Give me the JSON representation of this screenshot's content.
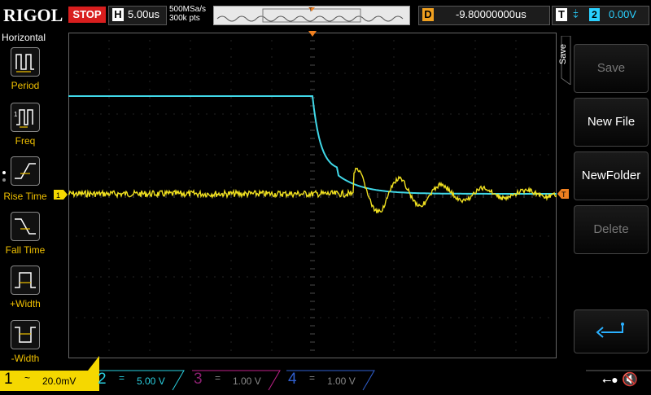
{
  "header": {
    "brand": "RIGOL",
    "run_state": "STOP",
    "horizontal": {
      "letter": "H",
      "timebase": "5.00us"
    },
    "sample_rate": "500MSa/s",
    "memory_depth": "300k pts",
    "delay": {
      "letter": "D",
      "value": "-9.80000000us"
    },
    "trigger": {
      "letter": "T",
      "source": "2",
      "level": "0.00V"
    }
  },
  "left_menu": {
    "title": "Horizontal",
    "items": [
      {
        "label": "Period",
        "icon": "period-icon"
      },
      {
        "label": "Freq",
        "icon": "frequency-icon"
      },
      {
        "label": "Rise Time",
        "icon": "rise-time-icon",
        "selected": true
      },
      {
        "label": "Fall Time",
        "icon": "fall-time-icon"
      },
      {
        "label": "+Width",
        "icon": "positive-width-icon"
      },
      {
        "label": "-Width",
        "icon": "negative-width-icon"
      }
    ]
  },
  "right_menu": {
    "tab": "Save",
    "buttons": [
      {
        "label": "Save",
        "enabled": false
      },
      {
        "label": "New File",
        "enabled": true
      },
      {
        "label": "NewFolder",
        "enabled": true
      },
      {
        "label": "Delete",
        "enabled": false
      },
      {
        "label": "",
        "icon": "enter-arrow-icon",
        "enabled": true
      }
    ]
  },
  "channels": [
    {
      "num": "1",
      "coupling": "~",
      "scale": "20.0mV",
      "color": "#f5d800",
      "active": true
    },
    {
      "num": "2",
      "coupling": "=",
      "scale": "5.00 V",
      "color": "#2ad0e0",
      "active": true
    },
    {
      "num": "3",
      "coupling": "=",
      "scale": "1.00 V",
      "color": "#c0208a",
      "active": false
    },
    {
      "num": "4",
      "coupling": "=",
      "scale": "1.00 V",
      "color": "#3060d0",
      "active": false
    }
  ],
  "waveform_colors": {
    "ch1": "#f0e020",
    "ch2": "#40d8e8",
    "grid": "#4a4a4a",
    "trigger_marker": "#f08020"
  },
  "status_icons": [
    "usb-icon",
    "speaker-muted-icon"
  ]
}
